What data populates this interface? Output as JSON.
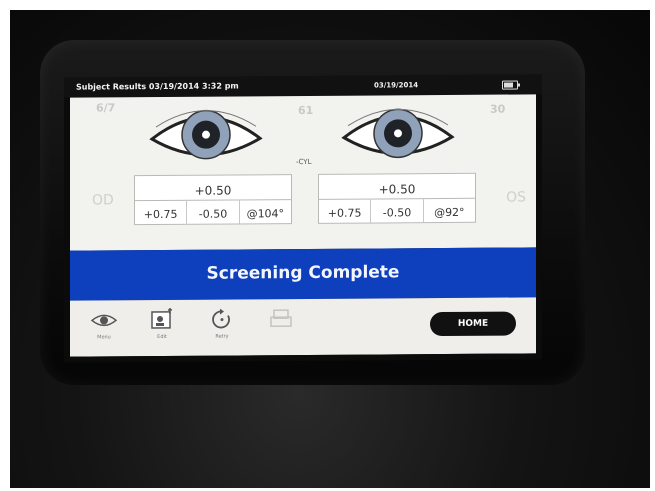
{
  "status_bar": {
    "title": "Subject Results  03/19/2014 3:32 pm",
    "date": "03/19/2014",
    "battery_icon": "battery-icon"
  },
  "left_eye": {
    "label": "OD",
    "sphere": "+0.50",
    "values": [
      "+0.75",
      "-0.50",
      "@104°"
    ]
  },
  "right_eye": {
    "label": "OS",
    "sphere": "+0.50",
    "values": [
      "+0.75",
      "-0.50",
      "@92°"
    ]
  },
  "cyl_label": "-CYL",
  "banner": {
    "text": "Screening Complete",
    "color": "#0e3fbd"
  },
  "toolbar": {
    "items": [
      {
        "label": "Menu",
        "icon": "eye-icon"
      },
      {
        "label": "Edit",
        "icon": "edit-user-icon"
      },
      {
        "label": "Retry",
        "icon": "retry-icon"
      },
      {
        "label": "",
        "icon": "print-icon"
      }
    ],
    "home_label": "HOME"
  }
}
